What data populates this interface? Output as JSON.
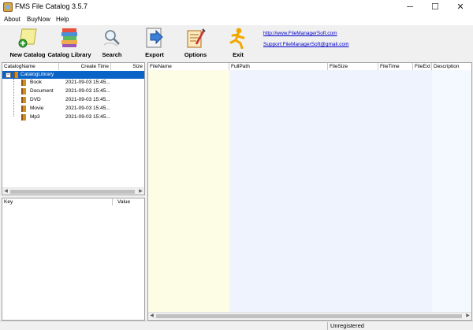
{
  "window": {
    "title": "FMS File Catalog 3.5.7",
    "controls": {
      "minimize": "─",
      "maximize": "☐",
      "close": "✕"
    }
  },
  "menu": {
    "items": [
      "About",
      "BuyNow",
      "Help"
    ]
  },
  "toolbar": {
    "buttons": [
      {
        "label": "New Catalog",
        "icon": "new-catalog-icon"
      },
      {
        "label": "Catalog Library",
        "icon": "books-icon"
      },
      {
        "label": "Search",
        "icon": "search-icon"
      },
      {
        "label": "Export",
        "icon": "export-icon"
      },
      {
        "label": "Options",
        "icon": "options-icon"
      },
      {
        "label": "Exit",
        "icon": "exit-icon"
      }
    ],
    "links": [
      "http://www.FileManagerSoft.com",
      "Support:FileManagerSoft@gmail.com"
    ]
  },
  "catalog_tree": {
    "columns": [
      "CatalogName",
      "Create Time",
      "Size"
    ],
    "root": "CatalogLibrary",
    "items": [
      {
        "name": "Book",
        "time": "2021-09-03 15:45..."
      },
      {
        "name": "Document",
        "time": "2021-09-03 15:45..."
      },
      {
        "name": "DVD",
        "time": "2021-09-03 15:45..."
      },
      {
        "name": "Movie",
        "time": "2021-09-03 15:45..."
      },
      {
        "name": "Mp3",
        "time": "2021-09-03 15:45..."
      }
    ]
  },
  "properties": {
    "columns": [
      "Key",
      "Value"
    ]
  },
  "file_list": {
    "columns": [
      "FileName",
      "FullPath",
      "FileSize",
      "FileTime",
      "FileExt",
      "Description"
    ]
  },
  "status": {
    "registration": "Unregistered"
  },
  "colors": {
    "selection": "#0a64c8",
    "filename_column": "#fdfde6",
    "fullpath_column": "#eef3fd",
    "link": "#0000cc"
  }
}
